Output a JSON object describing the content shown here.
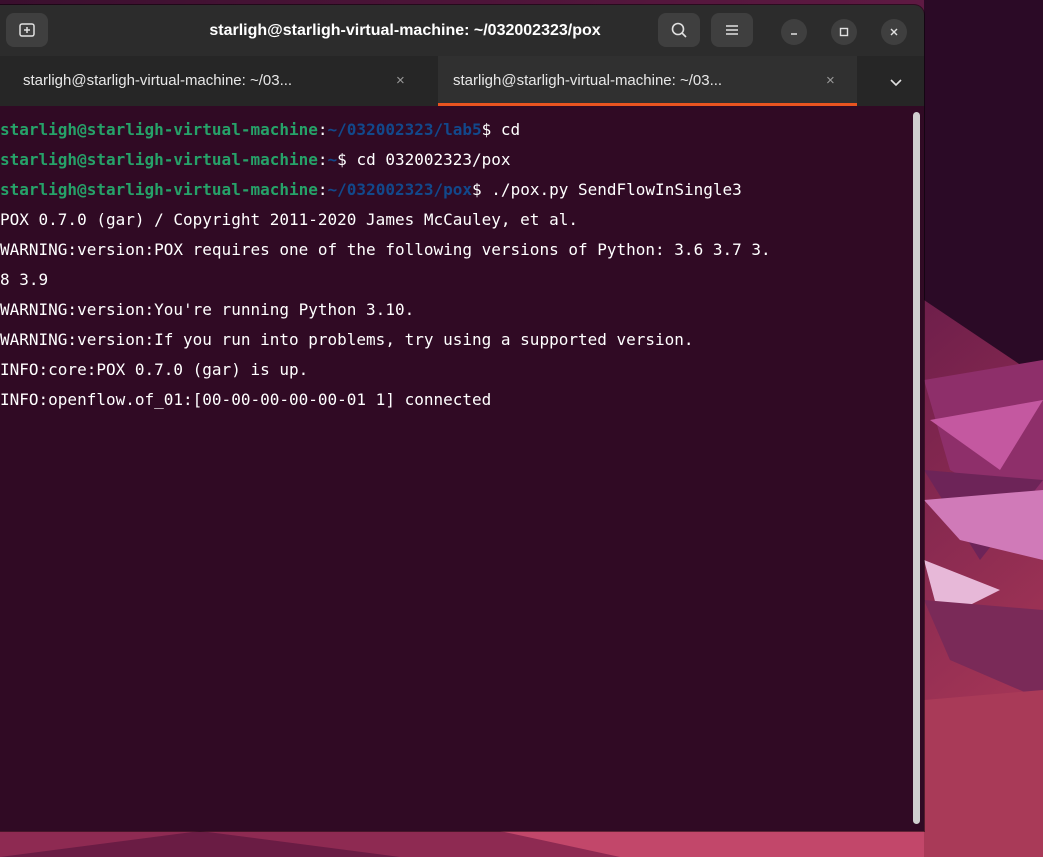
{
  "window": {
    "title": "starligh@starligh-virtual-machine: ~/032002323/pox"
  },
  "titlebar_buttons": {
    "new_tab_icon": "new-tab-icon",
    "search_icon": "search-icon",
    "menu_icon": "hamburger-menu-icon",
    "minimize_icon": "minimize-icon",
    "maximize_icon": "maximize-icon",
    "close_icon": "close-icon"
  },
  "tabs": [
    {
      "label": "starligh@starligh-virtual-machine: ~/03...",
      "close": "×",
      "active": false
    },
    {
      "label": "starligh@starligh-virtual-machine: ~/03...",
      "close": "×",
      "active": true
    }
  ],
  "tab_dropdown_icon": "chevron-down-icon",
  "terminal": {
    "line1": {
      "user": "starligh@starligh-virtual-machine",
      "sep": ":",
      "path": "~/032002323/lab5",
      "cmd": "$ cd"
    },
    "line2": {
      "user": "starligh@starligh-virtual-machine",
      "sep": ":",
      "path": "~",
      "cmd": "$ cd 032002323/pox"
    },
    "line3": {
      "user": "starligh@starligh-virtual-machine",
      "sep": ":",
      "path": "~/032002323/pox",
      "cmd": "$ ./pox.py SendFlowInSingle3"
    },
    "output": [
      "POX 0.7.0 (gar) / Copyright 2011-2020 James McCauley, et al.",
      "WARNING:version:POX requires one of the following versions of Python: 3.6 3.7 3.",
      "8 3.9",
      "WARNING:version:You're running Python 3.10.",
      "WARNING:version:If you run into problems, try using a supported version.",
      "INFO:core:POX 0.7.0 (gar) is up.",
      "INFO:openflow.of_01:[00-00-00-00-00-01 1] connected"
    ]
  },
  "colors": {
    "terminal_bg": "#300a24",
    "prompt_user": "#26a269",
    "prompt_path": "#12488b",
    "tab_accent": "#e95420"
  }
}
